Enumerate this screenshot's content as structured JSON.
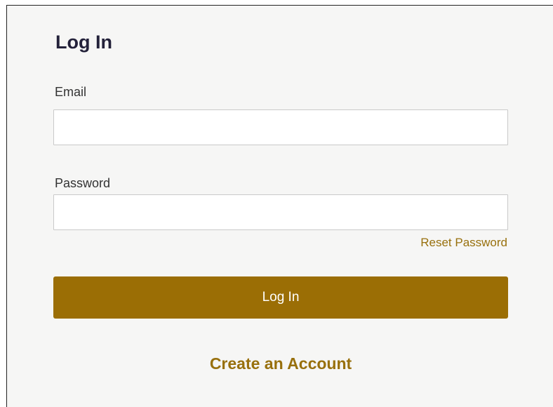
{
  "form": {
    "title": "Log In",
    "email_label": "Email",
    "email_value": "",
    "password_label": "Password",
    "password_value": "",
    "reset_link": "Reset Password",
    "submit_label": "Log In",
    "create_account_link": "Create an Account"
  },
  "colors": {
    "accent": "#9b6e05",
    "link": "#98700d",
    "title": "#23213a",
    "background": "#f6f6f5"
  }
}
